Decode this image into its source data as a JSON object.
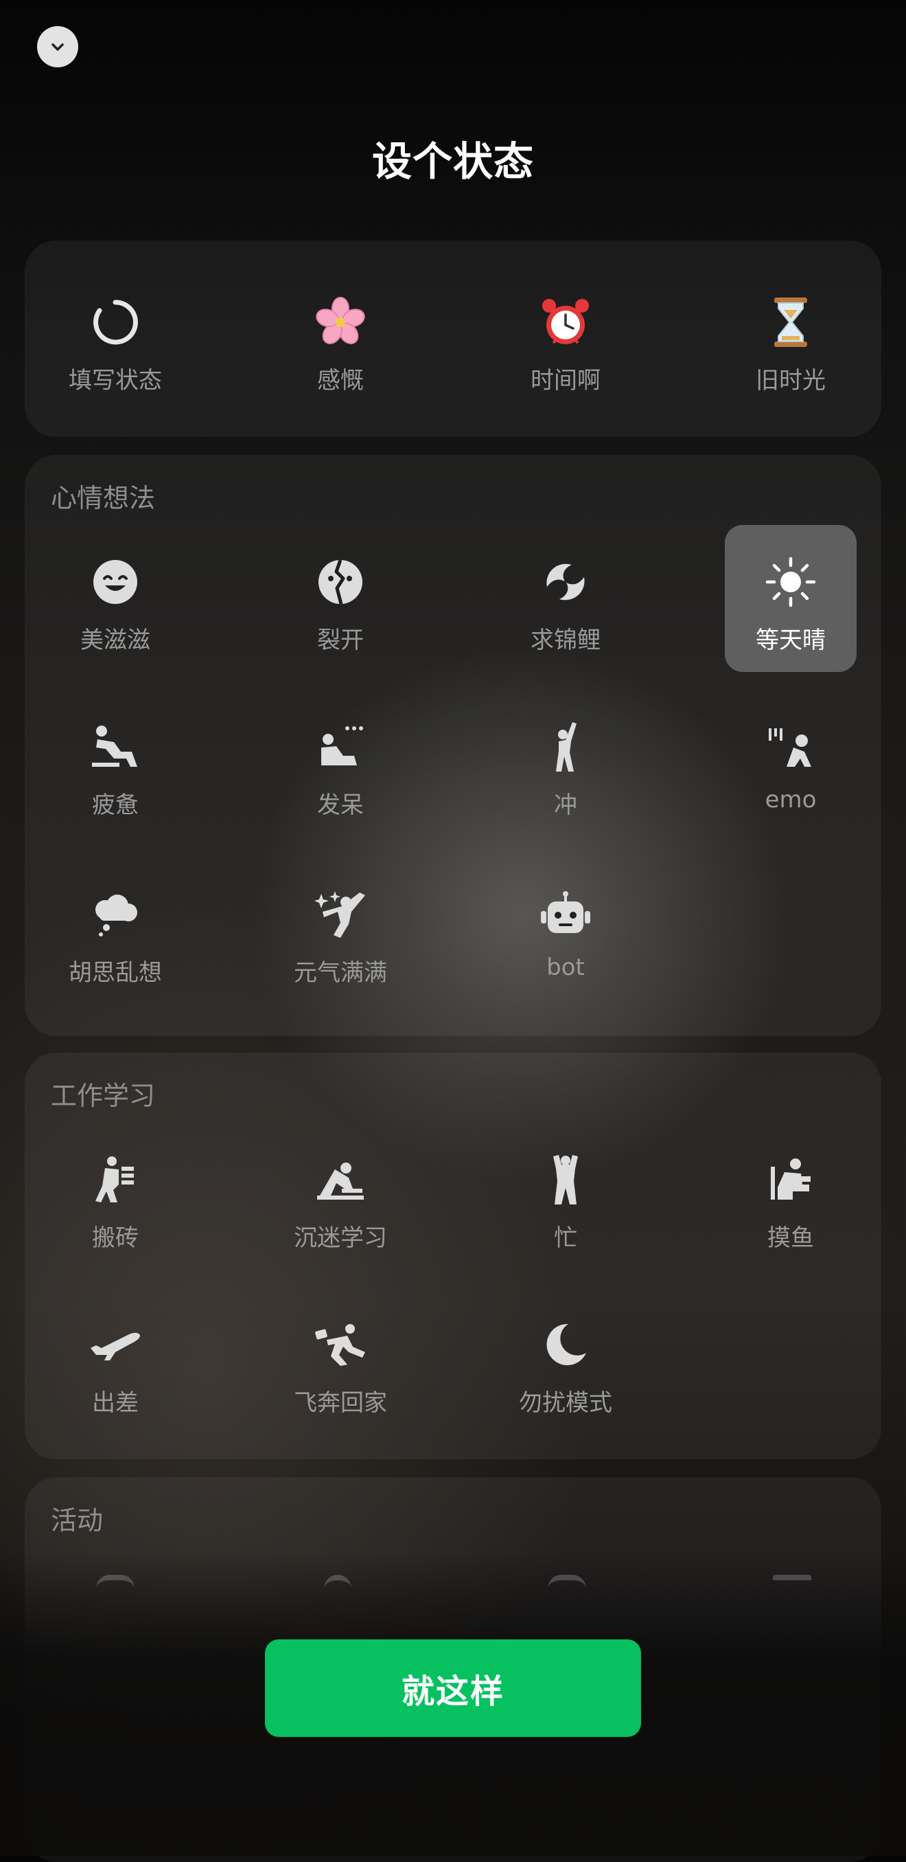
{
  "page": {
    "title": "设个状态"
  },
  "header": {
    "collapse_icon": "chevron-down-icon"
  },
  "top_row": [
    {
      "label": "填写状态",
      "icon": "ring-icon"
    },
    {
      "label": "感慨",
      "icon": "cherry-blossom-icon"
    },
    {
      "label": "时间啊",
      "icon": "alarm-clock-icon"
    },
    {
      "label": "旧时光",
      "icon": "hourglass-icon"
    }
  ],
  "sections": [
    {
      "title": "心情想法",
      "items": [
        {
          "label": "美滋滋",
          "icon": "smiling-face-icon"
        },
        {
          "label": "裂开",
          "icon": "cracked-face-icon"
        },
        {
          "label": "求锦鲤",
          "icon": "koi-fish-icon"
        },
        {
          "label": "等天晴",
          "icon": "sun-icon",
          "selected": true
        },
        {
          "label": "疲惫",
          "icon": "tired-person-icon"
        },
        {
          "label": "发呆",
          "icon": "daydream-person-icon"
        },
        {
          "label": "冲",
          "icon": "cheering-person-icon"
        },
        {
          "label": "emo",
          "icon": "sad-person-icon"
        },
        {
          "label": "胡思乱想",
          "icon": "thought-cloud-icon"
        },
        {
          "label": "元气满满",
          "icon": "energetic-person-icon"
        },
        {
          "label": "bot",
          "icon": "robot-icon"
        }
      ]
    },
    {
      "title": "工作学习",
      "items": [
        {
          "label": "搬砖",
          "icon": "carrying-bricks-icon"
        },
        {
          "label": "沉迷学习",
          "icon": "studying-person-icon"
        },
        {
          "label": "忙",
          "icon": "busy-person-icon"
        },
        {
          "label": "摸鱼",
          "icon": "slacking-person-icon"
        },
        {
          "label": "出差",
          "icon": "airplane-icon"
        },
        {
          "label": "飞奔回家",
          "icon": "running-home-icon"
        },
        {
          "label": "勿扰模式",
          "icon": "crescent-moon-icon"
        }
      ]
    },
    {
      "title": "活动",
      "items": []
    }
  ],
  "footer": {
    "confirm_label": "就这样"
  },
  "colors": {
    "accent": "#07c160",
    "selected_bg": "#5f5f5f"
  }
}
